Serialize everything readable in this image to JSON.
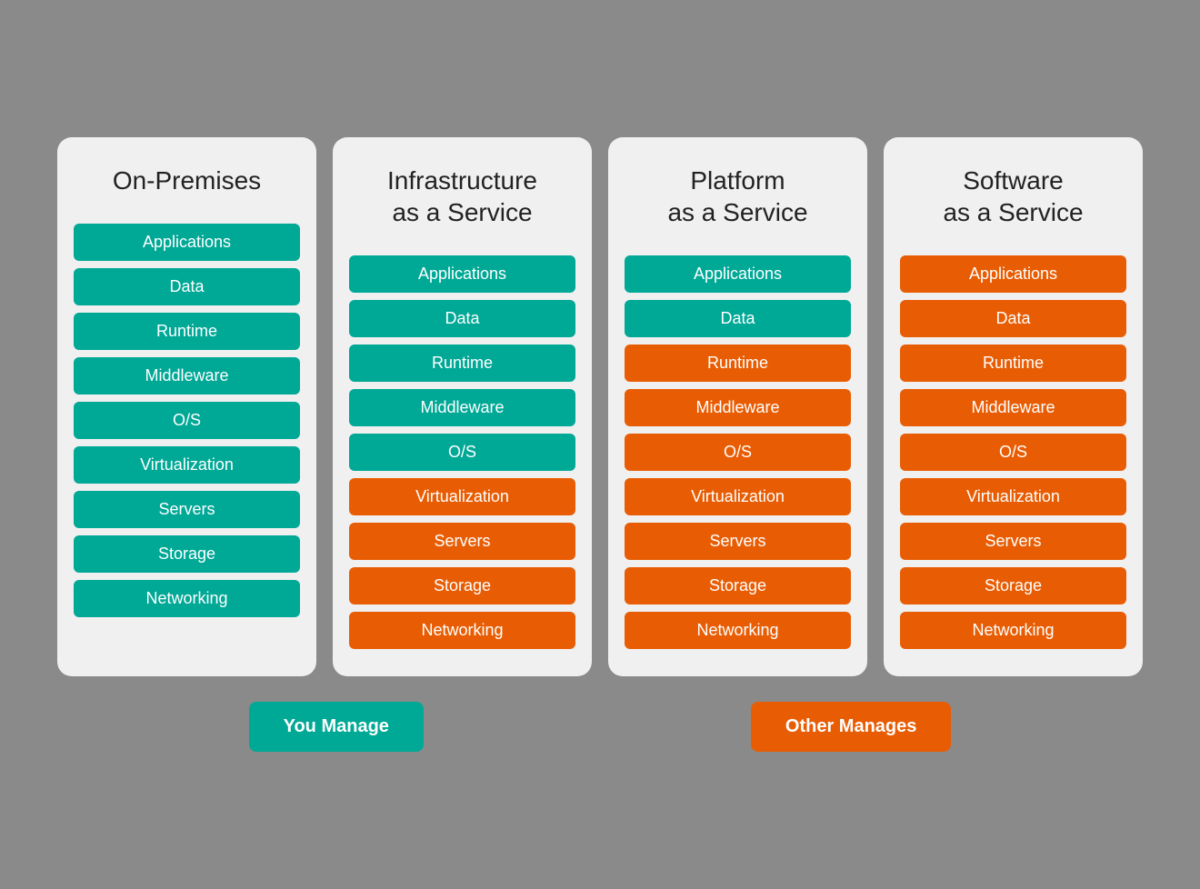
{
  "columns": [
    {
      "id": "on-premises",
      "title": "On-Premises",
      "items": [
        {
          "label": "Applications",
          "color": "teal"
        },
        {
          "label": "Data",
          "color": "teal"
        },
        {
          "label": "Runtime",
          "color": "teal"
        },
        {
          "label": "Middleware",
          "color": "teal"
        },
        {
          "label": "O/S",
          "color": "teal"
        },
        {
          "label": "Virtualization",
          "color": "teal"
        },
        {
          "label": "Servers",
          "color": "teal"
        },
        {
          "label": "Storage",
          "color": "teal"
        },
        {
          "label": "Networking",
          "color": "teal"
        }
      ]
    },
    {
      "id": "iaas",
      "title": "Infrastructure\nas a Service",
      "items": [
        {
          "label": "Applications",
          "color": "teal"
        },
        {
          "label": "Data",
          "color": "teal"
        },
        {
          "label": "Runtime",
          "color": "teal"
        },
        {
          "label": "Middleware",
          "color": "teal"
        },
        {
          "label": "O/S",
          "color": "teal"
        },
        {
          "label": "Virtualization",
          "color": "orange"
        },
        {
          "label": "Servers",
          "color": "orange"
        },
        {
          "label": "Storage",
          "color": "orange"
        },
        {
          "label": "Networking",
          "color": "orange"
        }
      ]
    },
    {
      "id": "paas",
      "title": "Platform\nas a Service",
      "items": [
        {
          "label": "Applications",
          "color": "teal"
        },
        {
          "label": "Data",
          "color": "teal"
        },
        {
          "label": "Runtime",
          "color": "orange"
        },
        {
          "label": "Middleware",
          "color": "orange"
        },
        {
          "label": "O/S",
          "color": "orange"
        },
        {
          "label": "Virtualization",
          "color": "orange"
        },
        {
          "label": "Servers",
          "color": "orange"
        },
        {
          "label": "Storage",
          "color": "orange"
        },
        {
          "label": "Networking",
          "color": "orange"
        }
      ]
    },
    {
      "id": "saas",
      "title": "Software\nas a Service",
      "items": [
        {
          "label": "Applications",
          "color": "orange"
        },
        {
          "label": "Data",
          "color": "orange"
        },
        {
          "label": "Runtime",
          "color": "orange"
        },
        {
          "label": "Middleware",
          "color": "orange"
        },
        {
          "label": "O/S",
          "color": "orange"
        },
        {
          "label": "Virtualization",
          "color": "orange"
        },
        {
          "label": "Servers",
          "color": "orange"
        },
        {
          "label": "Storage",
          "color": "orange"
        },
        {
          "label": "Networking",
          "color": "orange"
        }
      ]
    }
  ],
  "legend": {
    "you_manage": "You Manage",
    "other_manages": "Other Manages"
  }
}
